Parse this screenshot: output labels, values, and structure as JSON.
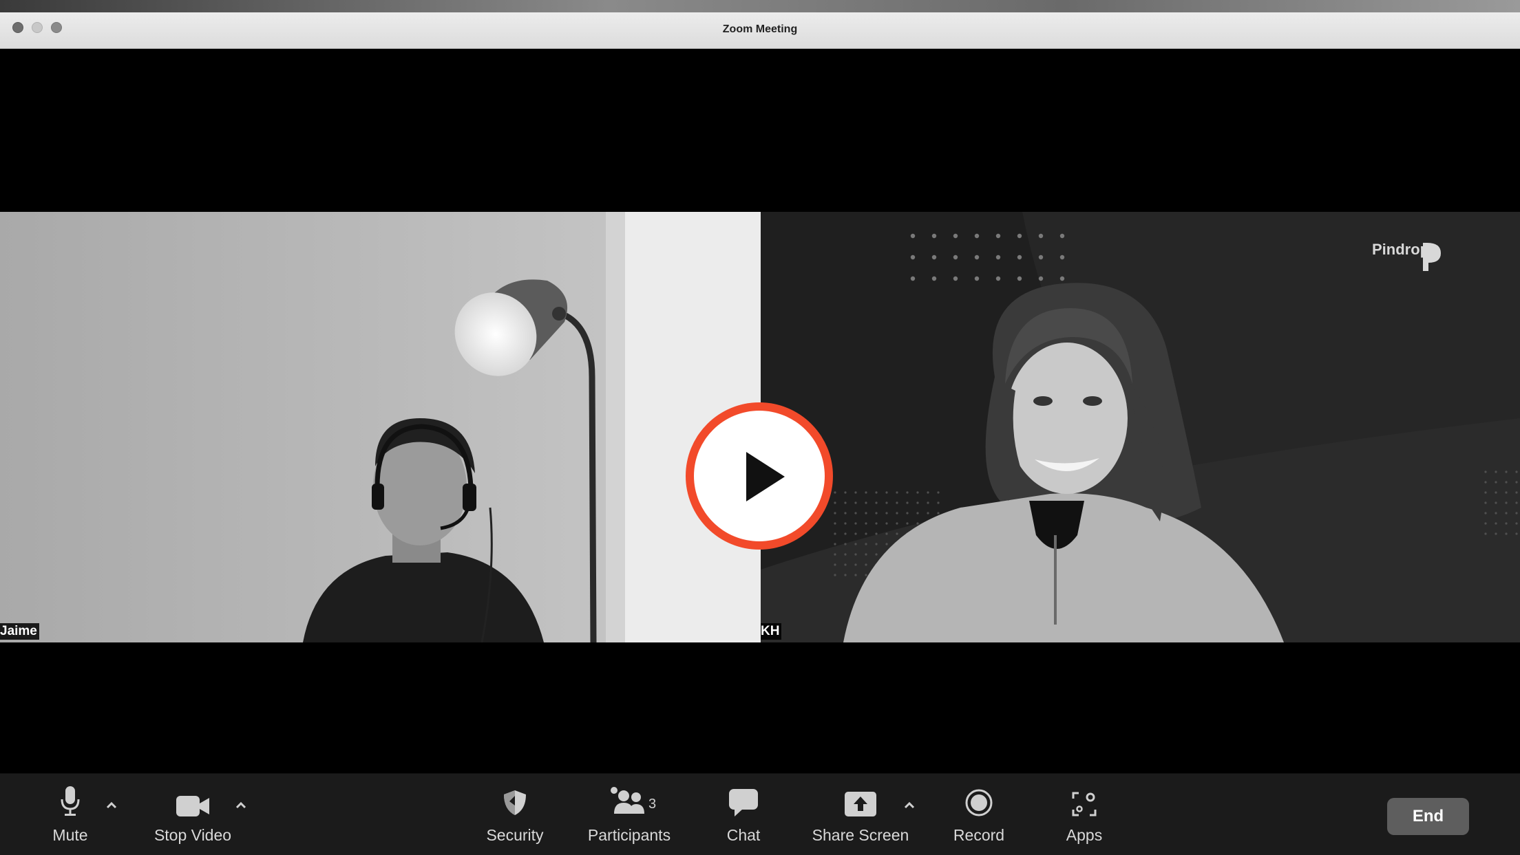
{
  "window": {
    "title": "Zoom Meeting"
  },
  "participants": [
    {
      "name": "Jaime"
    },
    {
      "name": "KH"
    }
  ],
  "watermark": "Pindrop",
  "accent": {
    "play": "#F24A2A"
  },
  "toolbar": {
    "mute": "Mute",
    "stop_video": "Stop Video",
    "security": "Security",
    "participants": "Participants",
    "participants_count": "3",
    "chat": "Chat",
    "share_screen": "Share Screen",
    "record": "Record",
    "apps": "Apps",
    "end": "End"
  }
}
